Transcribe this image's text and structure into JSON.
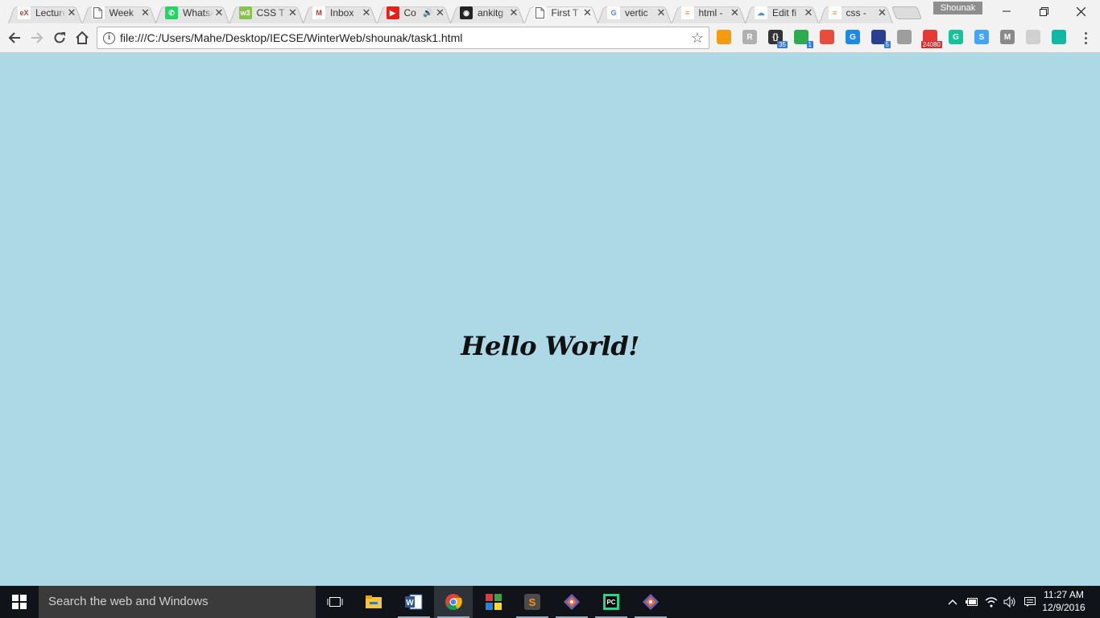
{
  "browser": {
    "profile_name": "Shounak",
    "tabs": [
      {
        "title": "Lecture",
        "favicon": "edx-icon",
        "active": false
      },
      {
        "title": "Week",
        "favicon": "document-icon",
        "active": false
      },
      {
        "title": "WhatsApp",
        "favicon": "whatsapp-icon",
        "active": false
      },
      {
        "title": "CSS T",
        "favicon": "w3-icon",
        "active": false
      },
      {
        "title": "Inbox",
        "favicon": "gmail-icon",
        "active": false
      },
      {
        "title": "Co",
        "favicon": "youtube-icon",
        "active": false,
        "audio": true
      },
      {
        "title": "ankitg",
        "favicon": "github-icon",
        "active": false
      },
      {
        "title": "First T",
        "favicon": "document-icon",
        "active": true
      },
      {
        "title": "vertic",
        "favicon": "google-icon",
        "active": false
      },
      {
        "title": "html -",
        "favicon": "stackoverflow-icon",
        "active": false
      },
      {
        "title": "Edit fi",
        "favicon": "cloud-icon",
        "active": false
      },
      {
        "title": "css - ",
        "favicon": "stackoverflow-icon",
        "active": false
      }
    ],
    "address": {
      "url": "file:///C:/Users/Mahe/Desktop/IECSE/WinterWeb/shounak/task1.html"
    },
    "extensions": [
      {
        "name": "orange-extension-icon",
        "label": "",
        "color": "#f39c12",
        "badge": ""
      },
      {
        "name": "r-extension-icon",
        "label": "R",
        "color": "#b0b0b0",
        "badge": ""
      },
      {
        "name": "braces-extension-icon",
        "label": "{}",
        "color": "#333333",
        "badge": "35"
      },
      {
        "name": "green-extension-icon",
        "label": "",
        "color": "#2eaa4f",
        "badge": "1"
      },
      {
        "name": "colorbar-extension-icon",
        "label": "",
        "color": "#e74c3c",
        "badge": ""
      },
      {
        "name": "g-extension-icon",
        "label": "G",
        "color": "#1e88e5",
        "badge": ""
      },
      {
        "name": "bars-extension-icon",
        "label": "",
        "color": "#2c3e90",
        "badge": "5"
      },
      {
        "name": "drive-extension-icon",
        "label": "",
        "color": "#9e9e9e",
        "badge": ""
      },
      {
        "name": "red-extension-icon",
        "label": "",
        "color": "#e53935",
        "badge": "24080"
      },
      {
        "name": "grammarly-extension-icon",
        "label": "G",
        "color": "#15c39a",
        "badge": ""
      },
      {
        "name": "s-extension-icon",
        "label": "S",
        "color": "#42a5f5",
        "badge": ""
      },
      {
        "name": "m-extension-icon",
        "label": "M",
        "color": "#8a8a8a",
        "badge": ""
      },
      {
        "name": "gray-extension-icon",
        "label": "",
        "color": "#d0d0d0",
        "badge": ""
      },
      {
        "name": "teal-extension-icon",
        "label": "",
        "color": "#0fb9a3",
        "badge": ""
      }
    ]
  },
  "page": {
    "heading": "Hello World!",
    "background": "#add8e6"
  },
  "taskbar": {
    "search_placeholder": "Search the web and Windows",
    "apps": [
      {
        "name": "task-view-icon",
        "open": false,
        "active": false
      },
      {
        "name": "file-explorer-icon",
        "open": false,
        "active": false
      },
      {
        "name": "word-icon",
        "open": true,
        "active": false
      },
      {
        "name": "chrome-icon",
        "open": true,
        "active": true
      },
      {
        "name": "app-tiles-icon",
        "open": false,
        "active": false
      },
      {
        "name": "sublime-text-icon",
        "open": true,
        "active": false
      },
      {
        "name": "git-icon",
        "open": true,
        "active": false
      },
      {
        "name": "pycharm-icon",
        "open": true,
        "active": false
      },
      {
        "name": "git-icon",
        "open": true,
        "active": false
      }
    ],
    "clock": {
      "time": "11:27 AM",
      "date": "12/9/2016"
    }
  }
}
